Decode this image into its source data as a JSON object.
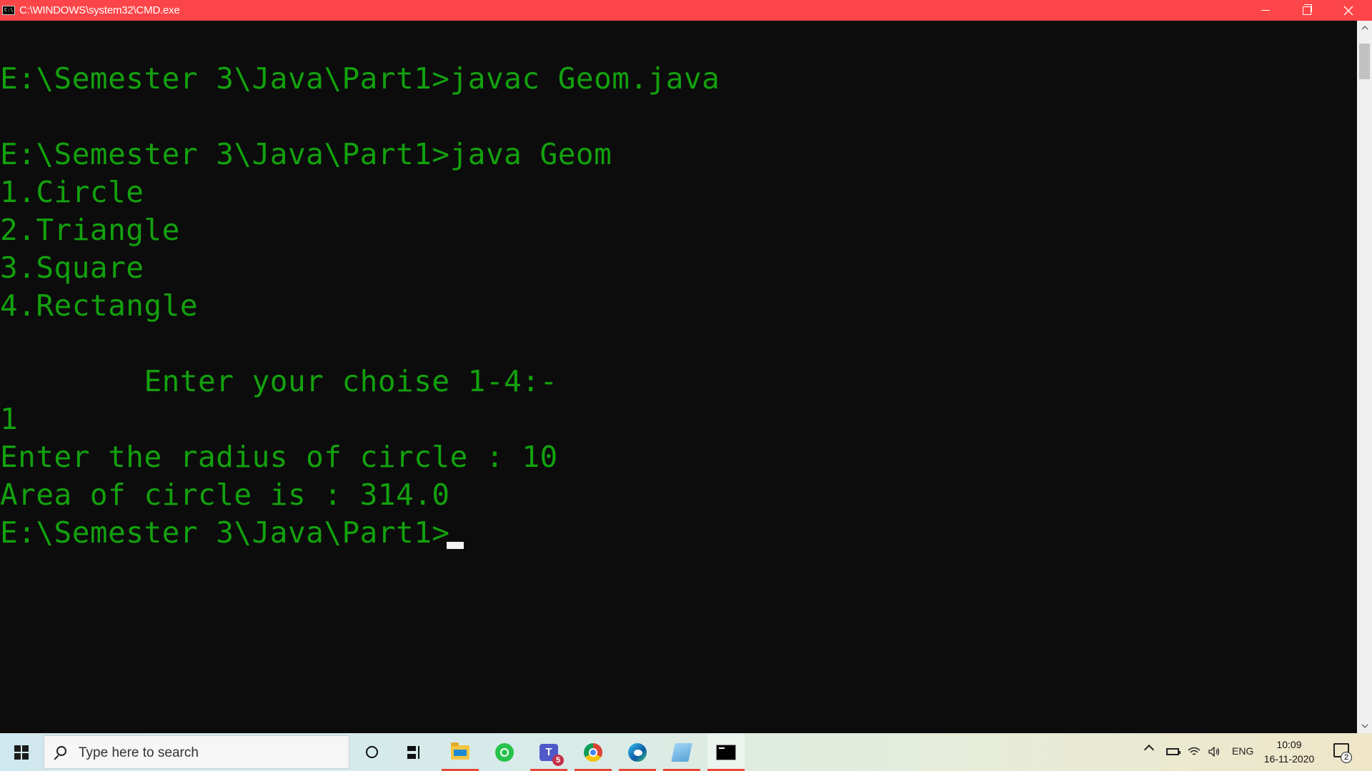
{
  "window": {
    "title": "C:\\WINDOWS\\system32\\CMD.exe",
    "icon": "cmd-icon",
    "title_bar_color": "#fc4548"
  },
  "console": {
    "text_color": "#13a10e",
    "background": "#0c0c0c",
    "lines": [
      "E:\\Semester 3\\Java\\Part1>javac Geom.java",
      "E:\\Semester 3\\Java\\Part1>java Geom",
      "1.Circle",
      "2.Triangle",
      "3.Square",
      "4.Rectangle",
      "        Enter your choise 1-4:-",
      "1",
      "Enter the radius of circle : 10",
      "Area of circle is : 314.0",
      "E:\\Semester 3\\Java\\Part1>"
    ]
  },
  "taskbar": {
    "search_placeholder": "Type here to search",
    "apps": [
      "cortana-icon",
      "task-view-icon",
      "file-explorer-icon",
      "whatsapp-icon",
      "teams-icon",
      "chrome-icon",
      "edge-icon",
      "notepad-icon",
      "cmd-icon"
    ],
    "teams_letter": "T",
    "teams_badge": "5",
    "language": "ENG",
    "time": "10:09",
    "date": "16-11-2020",
    "notification_count": "2"
  }
}
